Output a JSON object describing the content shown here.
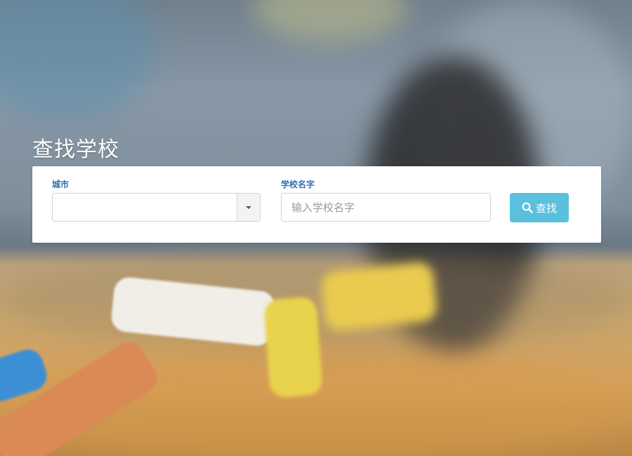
{
  "page": {
    "title": "查找学校"
  },
  "form": {
    "city_label": "城市",
    "city_value": "",
    "school_label": "学校名字",
    "school_placeholder": "输入学校名字",
    "school_value": "",
    "search_button_label": "查找",
    "search_button_icon": "search-icon",
    "dropdown_icon": "caret-down-icon"
  },
  "colors": {
    "label": "#2f6fb3",
    "button": "#5bc0de",
    "panel": "#ffffff"
  }
}
